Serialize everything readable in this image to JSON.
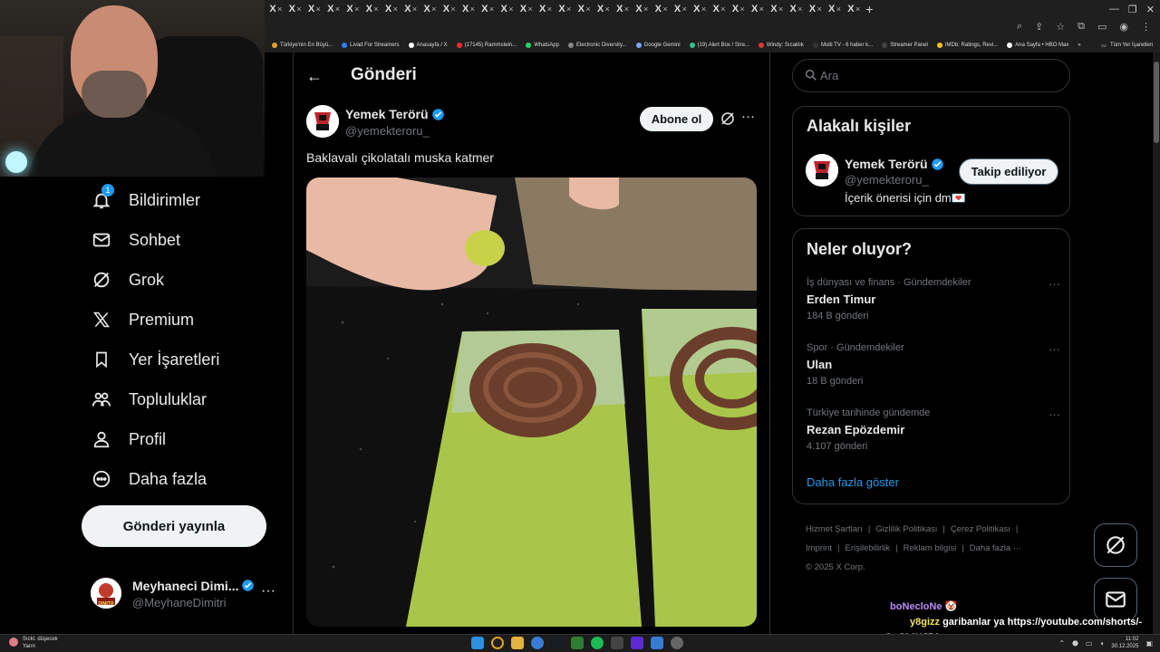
{
  "browser": {
    "tab_glyph": "X",
    "tab_close": "×",
    "new_tab": "+",
    "window_controls": [
      "—",
      "❐",
      "✕"
    ],
    "bookmarks": [
      {
        "label": "Türkiye'nin En Büyü...",
        "color": "#e0a030"
      },
      {
        "label": "Livad For Streamers",
        "color": "#2f80ff"
      },
      {
        "label": "Anasayfa / X",
        "color": "#ffffff"
      },
      {
        "label": "(17145) Rammstein...",
        "color": "#ff2a2a"
      },
      {
        "label": "WhatsApp",
        "color": "#25d366"
      },
      {
        "label": "Electronic Diversity...",
        "color": "#888888"
      },
      {
        "label": "Google Gemini",
        "color": "#7aa7ff"
      },
      {
        "label": "(19) Alert Box / Stre...",
        "color": "#31c48d"
      },
      {
        "label": "Windy: Sıcaklık",
        "color": "#d63a3a"
      },
      {
        "label": "Multi TV - 6 haber k...",
        "color": "#333333"
      },
      {
        "label": "Streamer Panel",
        "color": "#444444"
      },
      {
        "label": "IMDb: Ratings, Revi...",
        "color": "#f5c518"
      },
      {
        "label": "Ana Sayfa • HBO Max",
        "color": "#ffffff"
      }
    ],
    "bookmarks_overflow": "»",
    "all_bookmarks": "Tüm Yer İşaretleri"
  },
  "nav": {
    "items": [
      {
        "label": "Bildirimler",
        "icon": "bell-icon",
        "badge": "1"
      },
      {
        "label": "Sohbet",
        "icon": "mail-icon"
      },
      {
        "label": "Grok",
        "icon": "grok-icon"
      },
      {
        "label": "Premium",
        "icon": "x-logo-icon"
      },
      {
        "label": "Yer İşaretleri",
        "icon": "bookmark-icon"
      },
      {
        "label": "Topluluklar",
        "icon": "people-icon"
      },
      {
        "label": "Profil",
        "icon": "person-icon"
      },
      {
        "label": "Daha fazla",
        "icon": "more-circle-icon"
      }
    ],
    "post_button": "Gönderi yayınla",
    "account": {
      "name": "Meyhaneci Dimi...",
      "handle": "@MeyhaneDimitri",
      "avatar_text": "DIMITR",
      "more": "···"
    }
  },
  "post": {
    "page_title": "Gönderi",
    "back": "←",
    "author": {
      "name": "Yemek Terörü",
      "handle": "@yemekteroru_"
    },
    "subscribe": "Abone ol",
    "more": "···",
    "text": "Baklavalı çikolatalı muska katmer"
  },
  "sidebar": {
    "search_placeholder": "Ara",
    "related": {
      "title": "Alakalı kişiler",
      "name": "Yemek Terörü",
      "handle": "@yemekteroru_",
      "bio": "İçerik önerisi için dm💌",
      "follow": "Takip ediliyor"
    },
    "trends": {
      "title": "Neler oluyor?",
      "items": [
        {
          "context": "İş dünyası ve finans · Gündemdekiler",
          "name": "Erden Timur",
          "count": "184 B gönderi"
        },
        {
          "context": "Spor · Gündemdekiler",
          "name": "Ulan",
          "count": "18 B gönderi"
        },
        {
          "context": "Türkiye tarihinde gündemde",
          "name": "Rezan Epözdemir",
          "count": "4.107 gönderi"
        }
      ],
      "more_glyph": "···",
      "show_more": "Daha fazla göster"
    },
    "footer": {
      "links": [
        "Hizmet Şartları",
        "Gizlilik Politikası",
        "Çerez Politikası",
        "Imprint",
        "Erişilebilirlik",
        "Reklam bilgisi",
        "Daha fazla ···"
      ],
      "sep": "|",
      "copyright": "© 2025 X Corp."
    }
  },
  "chat": [
    {
      "user": "boNecloNe",
      "message": ""
    },
    {
      "user": "y8gizz",
      "message": "garibanlar ya https://youtube.com/shorts/-aQuJ64HJ54"
    }
  ],
  "taskbar": {
    "weather_title": "Sıckl. düşecek",
    "weather_sub": "Yarın",
    "time": "11:02",
    "date": "30.12.2025"
  },
  "colors": {
    "accent": "#1d9bf0",
    "background": "#000000",
    "border": "#2f3336",
    "muted": "#71767b"
  }
}
